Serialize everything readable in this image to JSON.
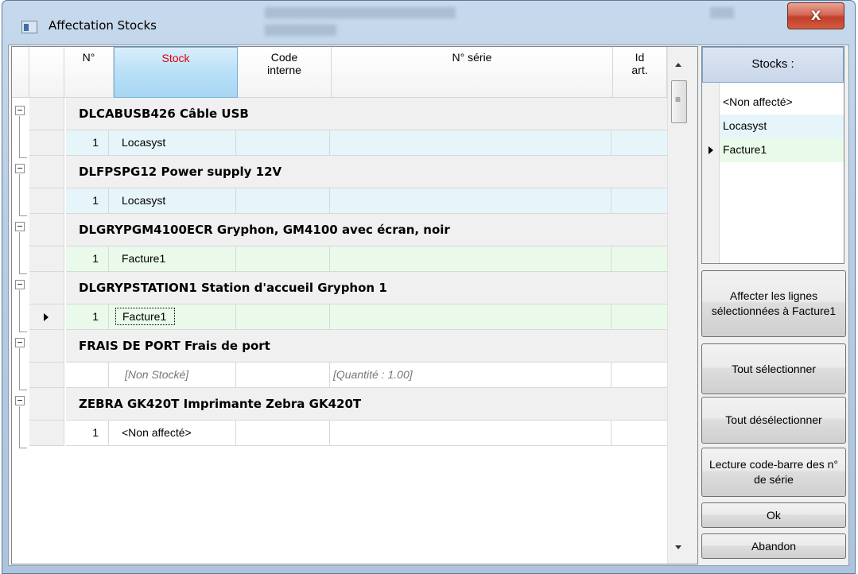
{
  "window": {
    "title": "Affectation Stocks",
    "close_glyph": "X"
  },
  "grid": {
    "columns": {
      "num": "N°",
      "stock": "Stock",
      "code_line1": "Code",
      "code_line2": "interne",
      "serie": "N° série",
      "id_line1": "Id",
      "id_line2": "art."
    },
    "groups": [
      {
        "label": "DLCABUSB426 Câble USB",
        "row": {
          "num": "1",
          "stock": "Locasyst"
        }
      },
      {
        "label": "DLFPSPG12 Power supply 12V",
        "row": {
          "num": "1",
          "stock": "Locasyst"
        }
      },
      {
        "label": "DLGRYPGM4100ECR Gryphon, GM4100 avec écran, noir",
        "row": {
          "num": "1",
          "stock": "Facture1"
        }
      },
      {
        "label": "DLGRYPSTATION1 Station d'accueil Gryphon 1",
        "row": {
          "num": "1",
          "stock": "Facture1"
        }
      },
      {
        "label": "FRAIS DE PORT Frais de port",
        "row": {
          "stock": "[Non Stocké]",
          "serie": "[Quantité : 1.00]"
        }
      },
      {
        "label": "ZEBRA GK420T Imprimante Zebra GK420T",
        "row": {
          "num": "1",
          "stock": "<Non affecté>"
        }
      }
    ]
  },
  "stocks": {
    "header": "Stocks :",
    "items": [
      "<Non affecté>",
      "Locasyst",
      "Facture1"
    ]
  },
  "buttons": {
    "assign": "Affecter les lignes sélectionnées à Facture1",
    "select_all": "Tout sélectionner",
    "deselect_all": "Tout désélectionner",
    "barcode": "Lecture code-barre des n° de série",
    "ok": "Ok",
    "cancel": "Abandon"
  }
}
